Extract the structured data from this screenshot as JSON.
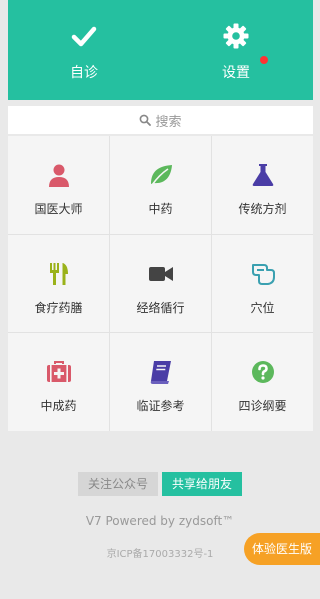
{
  "header": {
    "self_diagnosis": {
      "label": "自诊",
      "icon": "check-icon"
    },
    "settings": {
      "label": "设置",
      "icon": "gear-icon",
      "has_notification": true
    }
  },
  "search": {
    "placeholder": "搜索",
    "icon": "search-icon"
  },
  "menu": [
    {
      "label": "国医大师",
      "icon": "person-icon",
      "color": "#d9596a"
    },
    {
      "label": "中药",
      "icon": "leaf-icon",
      "color": "#5cb85c"
    },
    {
      "label": "传统方剂",
      "icon": "flask-icon",
      "color": "#4a3da6"
    },
    {
      "label": "食疗药膳",
      "icon": "utensils-icon",
      "color": "#9ab21a"
    },
    {
      "label": "经络循行",
      "icon": "video-camera-icon",
      "color": "#444444"
    },
    {
      "label": "穴位",
      "icon": "hand-pointer-icon",
      "color": "#3aa0b0"
    },
    {
      "label": "中成药",
      "icon": "medkit-icon",
      "color": "#d9596a"
    },
    {
      "label": "临证参考",
      "icon": "book-icon",
      "color": "#4a3da6"
    },
    {
      "label": "四诊纲要",
      "icon": "question-circle-icon",
      "color": "#5cb85c"
    }
  ],
  "footer": {
    "follow_label": "关注公众号",
    "share_label": "共享给朋友",
    "powered": "V7 Powered by zydsoft™",
    "icp": "京ICP备17003332号-1",
    "trial_label": "体验医生版"
  },
  "colors": {
    "accent": "#25c0a0",
    "trial": "#f6a125"
  }
}
